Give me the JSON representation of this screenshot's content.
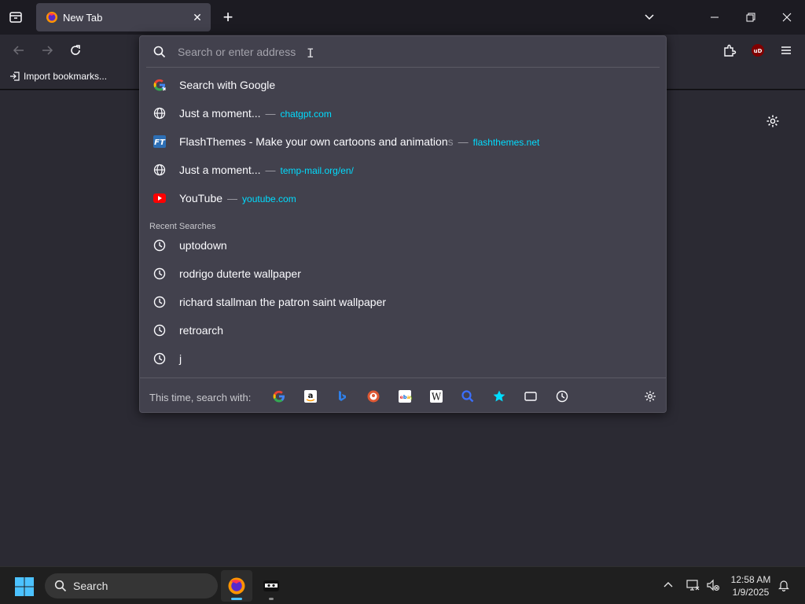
{
  "tab": {
    "title": "New Tab",
    "close_glyph": "✕"
  },
  "newtab_glyph": "+",
  "bookmarks": {
    "import_label": "Import bookmarks..."
  },
  "urlbar": {
    "placeholder": "Search or enter address",
    "results": [
      {
        "icon": "google-icon",
        "title": "Search with Google",
        "url": ""
      },
      {
        "icon": "globe-icon",
        "title": "Just a moment...",
        "separator": "—",
        "url": "chatgpt.com"
      },
      {
        "icon": "flashthemes-icon",
        "title": "FlashThemes - Make your own cartoons and animation",
        "fade": "s",
        "separator": "—",
        "url": "flashthemes.net"
      },
      {
        "icon": "globe-icon",
        "title": "Just a moment...",
        "separator": "—",
        "url": "temp-mail.org/en/"
      },
      {
        "icon": "youtube-icon",
        "title": "YouTube",
        "separator": "—",
        "url": "youtube.com"
      }
    ],
    "recent_label": "Recent Searches",
    "recent": [
      "uptodown",
      "rodrigo duterte wallpaper",
      "richard stallman the patron saint wallpaper",
      "retroarch",
      "j"
    ],
    "oneoff_label": "This time, search with:",
    "oneoff_engines": [
      "google-icon",
      "amazon-icon",
      "bing-icon",
      "duckduckgo-icon",
      "ebay-icon",
      "wikipedia-icon",
      "search-icon",
      "bookmarks-star-icon",
      "tabs-icon",
      "history-icon"
    ]
  },
  "taskbar": {
    "search_label": "Search",
    "time": "12:58 AM",
    "date": "1/9/2025"
  },
  "colors": {
    "accent_url": "#00ddff",
    "popup_bg": "#42414d",
    "toolbar_bg": "#2b2a33",
    "frame_bg": "#1c1b22"
  }
}
